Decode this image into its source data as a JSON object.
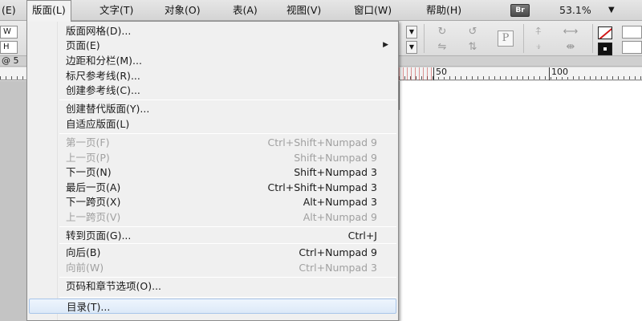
{
  "menubar": {
    "items": [
      "(E)",
      "版面(L)",
      "文字(T)",
      "对象(O)",
      "表(A)",
      "视图(V)",
      "窗口(W)",
      "帮助(H)"
    ],
    "bridge_badge": "Br",
    "zoom": "53.1%",
    "zoom_arrow": "▼"
  },
  "toolbar": {
    "field_labels": [
      "W",
      "H"
    ]
  },
  "tabrow": {
    "label": "@ 5"
  },
  "ruler": {
    "marks": [
      "50",
      "100"
    ]
  },
  "menu": {
    "items": [
      {
        "label": "版面网格(D)...",
        "shortcut": "",
        "disabled": false,
        "submenu": false
      },
      {
        "label": "页面(E)",
        "shortcut": "",
        "disabled": false,
        "submenu": true
      },
      {
        "label": "边距和分栏(M)...",
        "shortcut": "",
        "disabled": false,
        "submenu": false
      },
      {
        "label": "标尺参考线(R)...",
        "shortcut": "",
        "disabled": false,
        "submenu": false
      },
      {
        "label": "创建参考线(C)...",
        "shortcut": "",
        "disabled": false,
        "submenu": false
      },
      {
        "label": "创建替代版面(Y)...",
        "shortcut": "",
        "disabled": false,
        "submenu": false
      },
      {
        "label": "自适应版面(L)",
        "shortcut": "",
        "disabled": false,
        "submenu": false
      },
      {
        "label": "第一页(F)",
        "shortcut": "Ctrl+Shift+Numpad 9",
        "disabled": true,
        "submenu": false
      },
      {
        "label": "上一页(P)",
        "shortcut": "Shift+Numpad 9",
        "disabled": true,
        "submenu": false
      },
      {
        "label": "下一页(N)",
        "shortcut": "Shift+Numpad 3",
        "disabled": false,
        "submenu": false
      },
      {
        "label": "最后一页(A)",
        "shortcut": "Ctrl+Shift+Numpad 3",
        "disabled": false,
        "submenu": false
      },
      {
        "label": "下一跨页(X)",
        "shortcut": "Alt+Numpad 3",
        "disabled": false,
        "submenu": false
      },
      {
        "label": "上一跨页(V)",
        "shortcut": "Alt+Numpad 9",
        "disabled": true,
        "submenu": false
      },
      {
        "label": "转到页面(G)...",
        "shortcut": "Ctrl+J",
        "disabled": false,
        "submenu": false
      },
      {
        "label": "向后(B)",
        "shortcut": "Ctrl+Numpad 9",
        "disabled": false,
        "submenu": false
      },
      {
        "label": "向前(W)",
        "shortcut": "Ctrl+Numpad 3",
        "disabled": true,
        "submenu": false
      },
      {
        "label": "页码和章节选项(O)...",
        "shortcut": "",
        "disabled": false,
        "submenu": false
      },
      {
        "label": "目录(T)...",
        "shortcut": "",
        "disabled": false,
        "submenu": false,
        "highlighted": true
      }
    ]
  }
}
